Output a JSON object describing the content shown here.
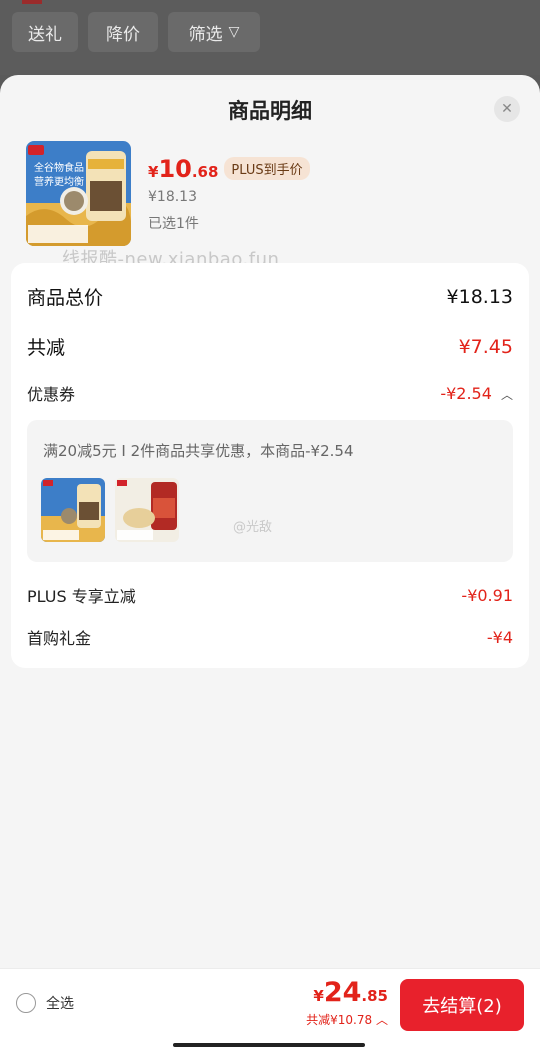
{
  "filters": {
    "gift": "送礼",
    "price_drop": "降价",
    "filter": "筛选",
    "filter_icon": "filter-icon"
  },
  "sheet": {
    "title": "商品明细",
    "close_icon": "close-icon"
  },
  "product": {
    "price_yen": "¥",
    "price_int": "10",
    "price_dec": ".68",
    "plus_badge": "PLUS到手价",
    "original_price": "¥18.13",
    "selected": "已选1件",
    "image_caption_1": "全谷物食品",
    "image_caption_2": "营养更均衡"
  },
  "watermark": "线报酷-new.xianbao.fun",
  "breakdown": {
    "total_label": "商品总价",
    "total_value": "¥18.13",
    "reduce_label": "共减",
    "reduce_value": "¥7.45",
    "coupon_label": "优惠券",
    "coupon_value": "-¥2.54",
    "coupon_desc": "满20减5元 I 2件商品共享优惠，本商品-¥2.54",
    "weibo_mark": "@光敌",
    "plus_label": "PLUS 专享立减",
    "plus_value": "-¥0.91",
    "first_gift_label": "首购礼金",
    "first_gift_value": "-¥4"
  },
  "bottom": {
    "select_all": "全选",
    "price_yen": "¥",
    "price_int": "24",
    "price_dec": ".85",
    "total_reduce": "共减¥10.78",
    "checkout": "去结算(2)"
  },
  "colors": {
    "accent": "#e2231a",
    "button": "#e8212c"
  }
}
